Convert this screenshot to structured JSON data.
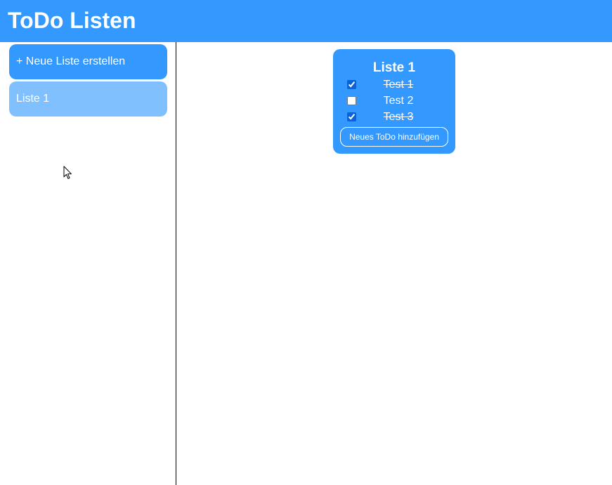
{
  "header": {
    "title": "ToDo Listen"
  },
  "sidebar": {
    "new_list_label": "+ Neue Liste erstellen",
    "lists": [
      {
        "label": "Liste 1"
      }
    ]
  },
  "main": {
    "card": {
      "title": "Liste 1",
      "todos": [
        {
          "label": "Test 1",
          "done": true
        },
        {
          "label": "Test 2",
          "done": false
        },
        {
          "label": "Test 3",
          "done": true
        }
      ],
      "add_button_label": "Neues ToDo hinzufügen"
    }
  },
  "colors": {
    "accent": "#3399ff",
    "selected_list": "#80c0ff",
    "text_on_accent": "#ffffff"
  },
  "icons": {
    "cursor": "mouse-pointer-icon"
  }
}
